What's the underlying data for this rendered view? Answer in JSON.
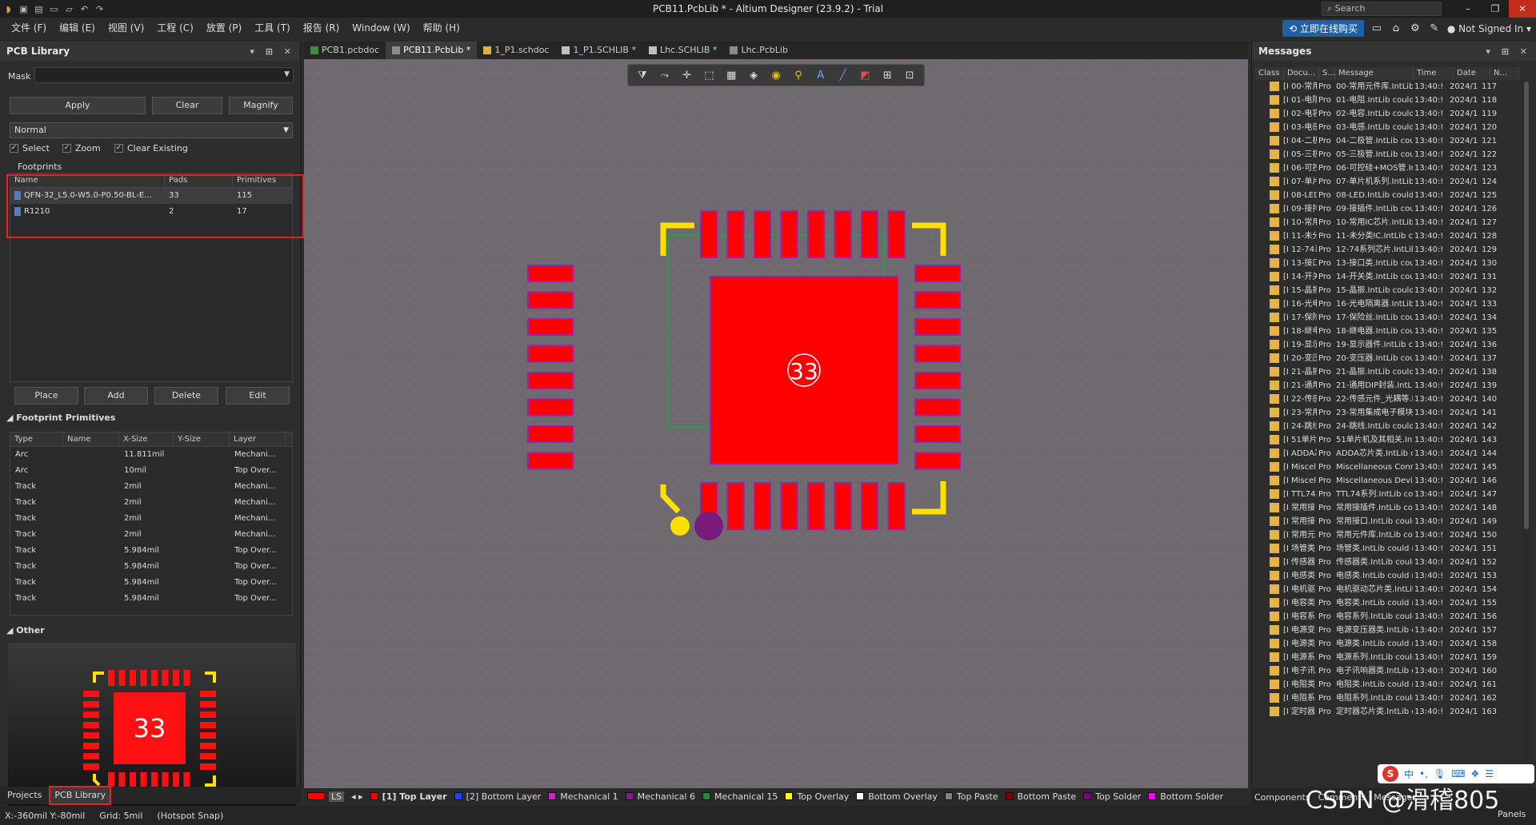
{
  "title": "PCB11.PcbLib * - Altium Designer (23.9.2) - Trial",
  "search_placeholder": "Search",
  "menu": [
    "文件 (F)",
    "编辑 (E)",
    "视图 (V)",
    "工程 (C)",
    "放置 (P)",
    "工具 (T)",
    "报告 (R)",
    "Window (W)",
    "帮助 (H)"
  ],
  "top_right": {
    "buy_label": "立即在线购买",
    "signed_in": "Not Signed In"
  },
  "left_panel": {
    "title": "PCB Library",
    "mask_label": "Mask",
    "mask_value": "",
    "buttons": {
      "apply": "Apply",
      "clear": "Clear",
      "magnify": "Magnify"
    },
    "mode": "Normal",
    "checks": [
      {
        "label": "Select",
        "checked": true
      },
      {
        "label": "Zoom",
        "checked": true
      },
      {
        "label": "Clear Existing",
        "checked": true
      }
    ],
    "footprints_title": "Footprints",
    "footprint_columns": [
      "Name",
      "Pads",
      "Primitives"
    ],
    "footprints": [
      {
        "name": "QFN-32_L5.0-W5.0-P0.50-BL-E...",
        "pads": "33",
        "primitives": "115"
      },
      {
        "name": "R1210",
        "pads": "2",
        "primitives": "17"
      }
    ],
    "fp_buttons": {
      "place": "Place",
      "add": "Add",
      "delete": "Delete",
      "edit": "Edit"
    },
    "primitives_title": "Footprint Primitives",
    "primitive_columns": [
      "Type",
      "Name",
      "X-Size",
      "Y-Size",
      "Layer"
    ],
    "primitives": [
      {
        "type": "Arc",
        "name": "",
        "xsize": "11.811mil",
        "ysize": "",
        "layer": "Mechani..."
      },
      {
        "type": "Arc",
        "name": "",
        "xsize": "10mil",
        "ysize": "",
        "layer": "Top Over..."
      },
      {
        "type": "Track",
        "name": "",
        "xsize": "2mil",
        "ysize": "",
        "layer": "Mechani..."
      },
      {
        "type": "Track",
        "name": "",
        "xsize": "2mil",
        "ysize": "",
        "layer": "Mechani..."
      },
      {
        "type": "Track",
        "name": "",
        "xsize": "2mil",
        "ysize": "",
        "layer": "Mechani..."
      },
      {
        "type": "Track",
        "name": "",
        "xsize": "2mil",
        "ysize": "",
        "layer": "Mechani..."
      },
      {
        "type": "Track",
        "name": "",
        "xsize": "5.984mil",
        "ysize": "",
        "layer": "Top Over..."
      },
      {
        "type": "Track",
        "name": "",
        "xsize": "5.984mil",
        "ysize": "",
        "layer": "Top Over..."
      },
      {
        "type": "Track",
        "name": "",
        "xsize": "5.984mil",
        "ysize": "",
        "layer": "Top Over..."
      },
      {
        "type": "Track",
        "name": "",
        "xsize": "5.984mil",
        "ysize": "",
        "layer": "Top Over..."
      }
    ],
    "other_title": "Other",
    "preview_pad_label": "33",
    "bottom_tabs": [
      "Projects",
      "PCB Library"
    ]
  },
  "doc_tabs": [
    "PCB1.pcbdoc",
    "PCB11.PcbLib *",
    "1_P1.schdoc",
    "1_P1.SCHLIB *",
    "Lhc.SCHLIB *",
    "Lhc.PcbLib"
  ],
  "canvas": {
    "center_pad_label": "33"
  },
  "layers": {
    "ls": "LS",
    "items": [
      {
        "label": "[1] Top Layer",
        "color": "#ff0000",
        "active": true
      },
      {
        "label": "[2] Bottom Layer",
        "color": "#1f3fff"
      },
      {
        "label": "Mechanical 1",
        "color": "#d020d0"
      },
      {
        "label": "Mechanical 6",
        "color": "#8a1a8a"
      },
      {
        "label": "Mechanical 15",
        "color": "#1e8a3a"
      },
      {
        "label": "Top Overlay",
        "color": "#ffff00"
      },
      {
        "label": "Bottom Overlay",
        "color": "#ffffff"
      },
      {
        "label": "Top Paste",
        "color": "#808080"
      },
      {
        "label": "Bottom Paste",
        "color": "#800000"
      },
      {
        "label": "Top Solder",
        "color": "#800080"
      },
      {
        "label": "Bottom Solder",
        "color": "#ff00ff"
      }
    ]
  },
  "status": {
    "coords": "X:-360mil Y:-80mil",
    "grid": "Grid: 5mil",
    "snap": "(Hotspot Snap)"
  },
  "messages": {
    "title": "Messages",
    "columns": [
      "Class",
      "Docu...",
      "S...",
      "Message",
      "Time",
      "Date",
      "N..."
    ],
    "rows": [
      {
        "doc": "[I 00-常用",
        "src": "Pro",
        "msg": "00-常用元件库.IntLib c",
        "time": "13:40:!",
        "date": "2024/1",
        "n": "117"
      },
      {
        "doc": "[I 01-电阻",
        "src": "Pro",
        "msg": "01-电阻.IntLib could nc",
        "time": "13:40:!",
        "date": "2024/1",
        "n": "118"
      },
      {
        "doc": "[I 02-电容",
        "src": "Pro",
        "msg": "02-电容.IntLib could nc",
        "time": "13:40:!",
        "date": "2024/1",
        "n": "119"
      },
      {
        "doc": "[I 03-电感",
        "src": "Pro",
        "msg": "03-电感.IntLib could nc",
        "time": "13:40:!",
        "date": "2024/1",
        "n": "120"
      },
      {
        "doc": "[I 04-二极",
        "src": "Pro",
        "msg": "04-二极管.IntLib could",
        "time": "13:40:!",
        "date": "2024/1",
        "n": "121"
      },
      {
        "doc": "[I 05-三极",
        "src": "Pro",
        "msg": "05-三极管.IntLib could",
        "time": "13:40:!",
        "date": "2024/1",
        "n": "122"
      },
      {
        "doc": "[I 06-可控",
        "src": "Pro",
        "msg": "06-可控硅+MOS管.Intl",
        "time": "13:40:!",
        "date": "2024/1",
        "n": "123"
      },
      {
        "doc": "[I 07-单片",
        "src": "Pro",
        "msg": "07-单片机系列.IntLib c",
        "time": "13:40:!",
        "date": "2024/1",
        "n": "124"
      },
      {
        "doc": "[I 08-LED.I",
        "src": "Pro",
        "msg": "08-LED.IntLib could not",
        "time": "13:40:!",
        "date": "2024/1",
        "n": "125"
      },
      {
        "doc": "[I 09-接排",
        "src": "Pro",
        "msg": "09-接插件.IntLib could",
        "time": "13:40:!",
        "date": "2024/1",
        "n": "126"
      },
      {
        "doc": "[I 10-常用",
        "src": "Pro",
        "msg": "10-常用IC芯片.IntLib c",
        "time": "13:40:!",
        "date": "2024/1",
        "n": "127"
      },
      {
        "doc": "[I 11-未分",
        "src": "Pro",
        "msg": "11-未分类IC.IntLib cou",
        "time": "13:40:!",
        "date": "2024/1",
        "n": "128"
      },
      {
        "doc": "[I 12-74系",
        "src": "Pro",
        "msg": "12-74系列芯片.IntLib c",
        "time": "13:40:!",
        "date": "2024/1",
        "n": "129"
      },
      {
        "doc": "[I 13-接口",
        "src": "Pro",
        "msg": "13-接口类.IntLib could",
        "time": "13:40:!",
        "date": "2024/1",
        "n": "130"
      },
      {
        "doc": "[I 14-开关",
        "src": "Pro",
        "msg": "14-开关类.IntLib could",
        "time": "13:40:!",
        "date": "2024/1",
        "n": "131"
      },
      {
        "doc": "[I 15-晶振",
        "src": "Pro",
        "msg": "15-晶振.IntLib could nc",
        "time": "13:40:!",
        "date": "2024/1",
        "n": "132"
      },
      {
        "doc": "[I 16-光电",
        "src": "Pro",
        "msg": "16-光电隔离器.IntLib c",
        "time": "13:40:!",
        "date": "2024/1",
        "n": "133"
      },
      {
        "doc": "[I 17-保险",
        "src": "Pro",
        "msg": "17-保险丝.IntLib could",
        "time": "13:40:!",
        "date": "2024/1",
        "n": "134"
      },
      {
        "doc": "[I 18-继电",
        "src": "Pro",
        "msg": "18-继电器.IntLib could",
        "time": "13:40:!",
        "date": "2024/1",
        "n": "135"
      },
      {
        "doc": "[I 19-显示",
        "src": "Pro",
        "msg": "19-显示器件.IntLib cou",
        "time": "13:40:!",
        "date": "2024/1",
        "n": "136"
      },
      {
        "doc": "[I 20-变压",
        "src": "Pro",
        "msg": "20-变压器.IntLib could",
        "time": "13:40:!",
        "date": "2024/1",
        "n": "137"
      },
      {
        "doc": "[I 21-晶振",
        "src": "Pro",
        "msg": "21-晶振.IntLib could nc",
        "time": "13:40:!",
        "date": "2024/1",
        "n": "138"
      },
      {
        "doc": "[I 21-通用",
        "src": "Pro",
        "msg": "21-通用DIP封装.IntLib",
        "time": "13:40:!",
        "date": "2024/1",
        "n": "139"
      },
      {
        "doc": "[I 22-传感",
        "src": "Pro",
        "msg": "22-传感元件_光耦等.I",
        "time": "13:40:!",
        "date": "2024/1",
        "n": "140"
      },
      {
        "doc": "[I 23-常用",
        "src": "Pro",
        "msg": "23-常用集成电子模块",
        "time": "13:40:!",
        "date": "2024/1",
        "n": "141"
      },
      {
        "doc": "[I 24-跳线",
        "src": "Pro",
        "msg": "24-跳线.IntLib could nc",
        "time": "13:40:!",
        "date": "2024/1",
        "n": "142"
      },
      {
        "doc": "[I 51单片",
        "src": "Pro",
        "msg": "51单片机及其相关.Int",
        "time": "13:40:!",
        "date": "2024/1",
        "n": "143"
      },
      {
        "doc": "[I ADDA芯",
        "src": "Pro",
        "msg": "ADDA芯片类.IntLib cou",
        "time": "13:40:!",
        "date": "2024/1",
        "n": "144"
      },
      {
        "doc": "[I Miscella",
        "src": "Pro",
        "msg": "Miscellaneous Connect",
        "time": "13:40:!",
        "date": "2024/1",
        "n": "145"
      },
      {
        "doc": "[I Miscella",
        "src": "Pro",
        "msg": "Miscellaneous Devices.I",
        "time": "13:40:!",
        "date": "2024/1",
        "n": "146"
      },
      {
        "doc": "[I TTL74系",
        "src": "Pro",
        "msg": "TTL74系列.IntLib could",
        "time": "13:40:!",
        "date": "2024/1",
        "n": "147"
      },
      {
        "doc": "[I 常用接",
        "src": "Pro",
        "msg": "常用接插件.IntLib cou",
        "time": "13:40:!",
        "date": "2024/1",
        "n": "148"
      },
      {
        "doc": "[I 常用接",
        "src": "Pro",
        "msg": "常用接口.IntLib could",
        "time": "13:40:!",
        "date": "2024/1",
        "n": "149"
      },
      {
        "doc": "[I 常用元",
        "src": "Pro",
        "msg": "常用元件库.IntLib cou",
        "time": "13:40:!",
        "date": "2024/1",
        "n": "150"
      },
      {
        "doc": "[I 场管类",
        "src": "Pro",
        "msg": "场管类.IntLib could no",
        "time": "13:40:!",
        "date": "2024/1",
        "n": "151"
      },
      {
        "doc": "[I 传感器",
        "src": "Pro",
        "msg": "传感器类.IntLib could",
        "time": "13:40:!",
        "date": "2024/1",
        "n": "152"
      },
      {
        "doc": "[I 电感类",
        "src": "Pro",
        "msg": "电感类.IntLib could no",
        "time": "13:40:!",
        "date": "2024/1",
        "n": "153"
      },
      {
        "doc": "[I 电机驱",
        "src": "Pro",
        "msg": "电机驱动芯片类.IntLit",
        "time": "13:40:!",
        "date": "2024/1",
        "n": "154"
      },
      {
        "doc": "[I 电容类",
        "src": "Pro",
        "msg": "电容类.IntLib could no",
        "time": "13:40:!",
        "date": "2024/1",
        "n": "155"
      },
      {
        "doc": "[I 电容系",
        "src": "Pro",
        "msg": "电容系列.IntLib could",
        "time": "13:40:!",
        "date": "2024/1",
        "n": "156"
      },
      {
        "doc": "[I 电源变",
        "src": "Pro",
        "msg": "电源变压器类.IntLib c",
        "time": "13:40:!",
        "date": "2024/1",
        "n": "157"
      },
      {
        "doc": "[I 电源类",
        "src": "Pro",
        "msg": "电源类.IntLib could no",
        "time": "13:40:!",
        "date": "2024/1",
        "n": "158"
      },
      {
        "doc": "[I 电源系",
        "src": "Pro",
        "msg": "电源系列.IntLib could",
        "time": "13:40:!",
        "date": "2024/1",
        "n": "159"
      },
      {
        "doc": "[I 电子讯",
        "src": "Pro",
        "msg": "电子讯响器类.IntLib c",
        "time": "13:40:!",
        "date": "2024/1",
        "n": "160"
      },
      {
        "doc": "[I 电阻类",
        "src": "Pro",
        "msg": "电阻类.IntLib could no",
        "time": "13:40:!",
        "date": "2024/1",
        "n": "161"
      },
      {
        "doc": "[I 电阻系",
        "src": "Pro",
        "msg": "电阻系列.IntLib could",
        "time": "13:40:!",
        "date": "2024/1",
        "n": "162"
      },
      {
        "doc": "[I 定时器",
        "src": "Pro",
        "msg": "定时器芯片类.IntLib c",
        "time": "13:40:!",
        "date": "2024/1",
        "n": "163"
      }
    ],
    "bottom_tabs": [
      "Components",
      "Comments",
      "Messages"
    ]
  },
  "watermark": "CSDN @滑稽805",
  "panels_label": "Panels"
}
